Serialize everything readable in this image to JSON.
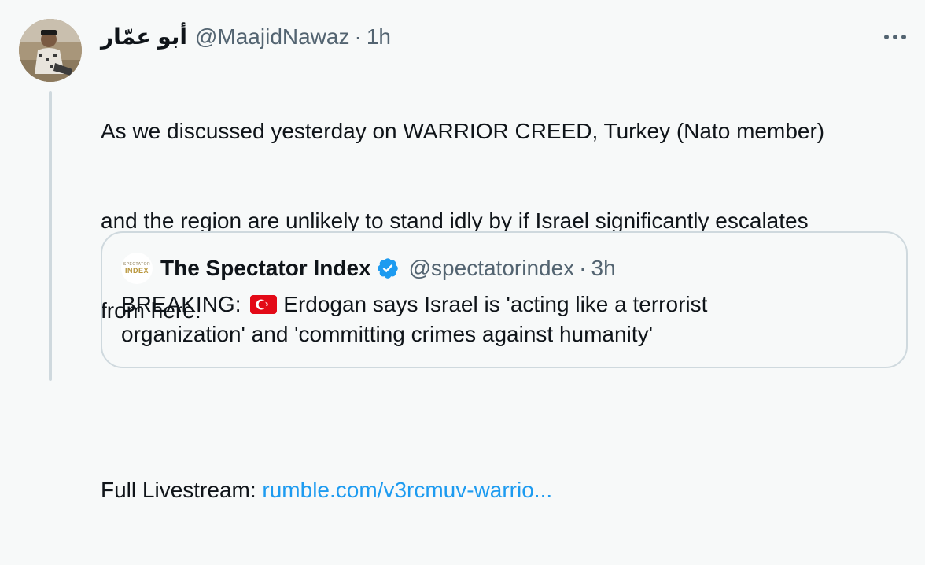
{
  "tweet": {
    "author": {
      "display_name": "أبو عمّار",
      "handle": "@MaajidNawaz",
      "separator": "·",
      "time": "1h",
      "avatar_icon": "profile-photo"
    },
    "more_icon": "more-options-icon",
    "text_lines": [
      "As we discussed yesterday on WARRIOR CREED, Turkey (Nato member)",
      "and the region are unlikely to stand idly by if Israel significantly escalates",
      "from here."
    ],
    "livestream_label": "Full Livestream: ",
    "livestream_link": "rumble.com/v3rcmuv-warrio..."
  },
  "quote": {
    "avatar_small_text": "SPECTATOR",
    "avatar_big_text": "INDEX",
    "display_name": "The Spectator Index",
    "verified_icon": "verified-badge-icon",
    "handle": "@spectatorindex",
    "separator": "·",
    "time": "3h",
    "text_prefix": "BREAKING: ",
    "flag_icon": "turkey-flag-icon",
    "text_line1_rest": "Erdogan says Israel is 'acting like a terrorist",
    "text_line2": "organization' and 'committing crimes against humanity'"
  },
  "colors": {
    "background": "#f7f9f9",
    "text": "#0f1419",
    "muted": "#536471",
    "link": "#1d9bf0",
    "border": "#cfd9de",
    "verified": "#1d9bf0",
    "flag_red": "#e30a17"
  }
}
